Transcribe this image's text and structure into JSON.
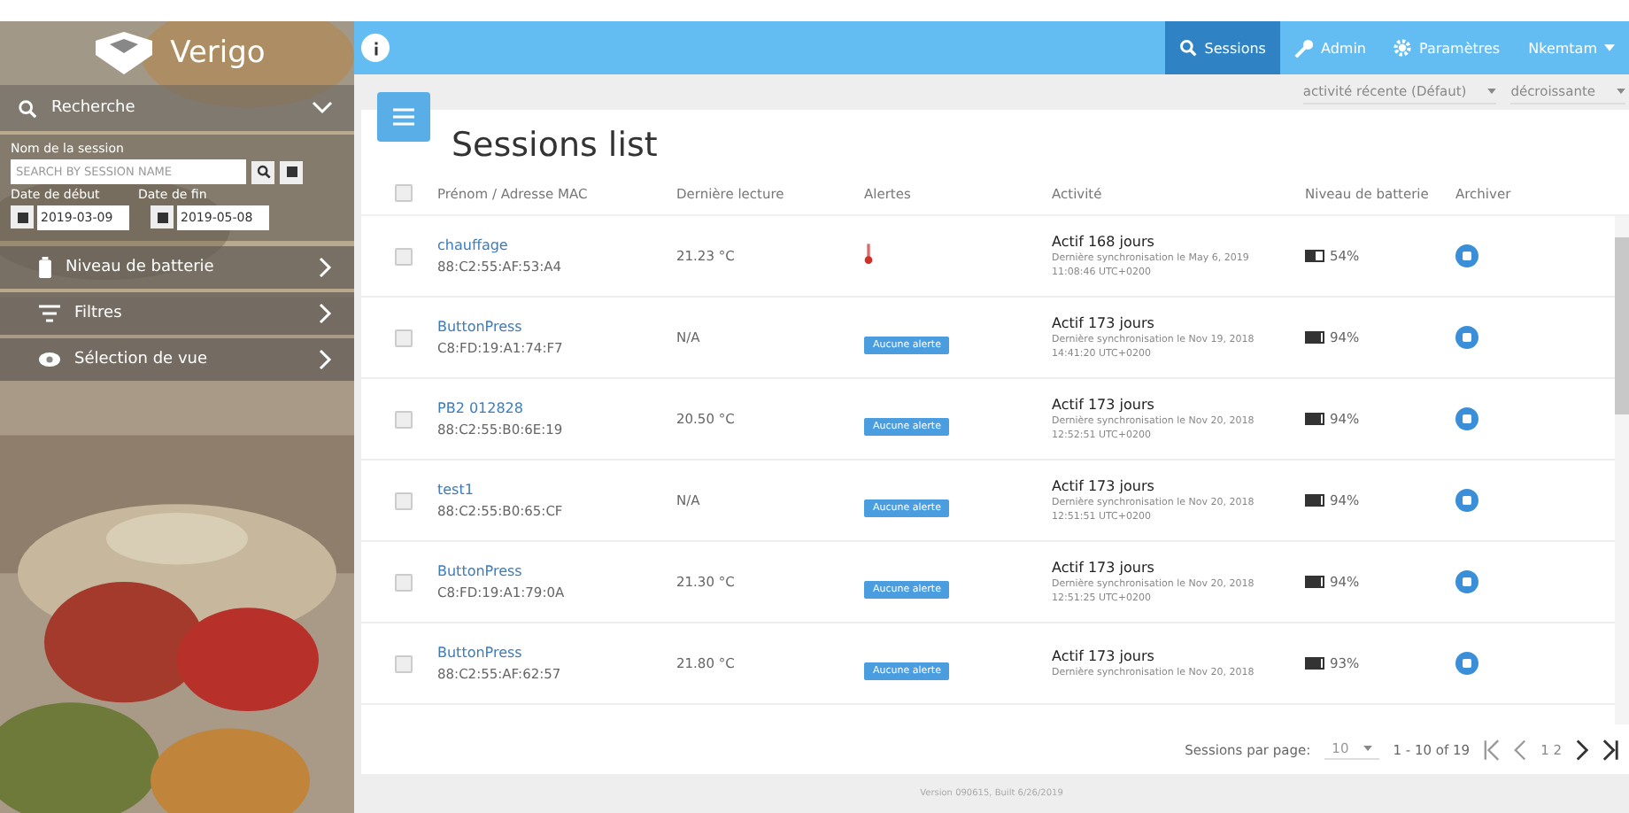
{
  "sidebar": {
    "logo": "Verigo",
    "search": {
      "title": "Recherche",
      "expanded": true,
      "name_label": "Nom de la session",
      "placeholder": "SEARCH BY SESSION NAME",
      "start_label": "Date de début",
      "end_label": "Date de fin",
      "start_date": "2019-03-09",
      "end_date": "2019-05-08"
    },
    "items": [
      {
        "label": "Niveau de batterie"
      },
      {
        "label": "Filtres"
      },
      {
        "label": "Sélection de vue"
      }
    ]
  },
  "navbar": {
    "items": [
      {
        "label": "Sessions",
        "selected": true
      },
      {
        "label": "Admin",
        "selected": false
      },
      {
        "label": "Paramètres",
        "selected": false
      },
      {
        "label": "Nkemtam",
        "selected": false
      }
    ]
  },
  "sort": {
    "field": "activité récente (Défaut)",
    "order": "décroissante"
  },
  "title": "Sessions list",
  "table": {
    "all_checked": false,
    "columns": [
      "Prénom / Adresse MAC",
      "Dernière lecture",
      "Alertes",
      "Activité",
      "Niveau de batterie",
      "Archiver"
    ],
    "rows": [
      {
        "checked": false,
        "name": "chauffage",
        "mac": "88:C2:55:AF:53:A4",
        "reading": "21.23 °C",
        "alert": {
          "kind": "thermometer"
        },
        "activity": "Actif 168 jours",
        "sync": "Dernière synchronisation le May 6, 2019",
        "time": "11:08:46 UTC+0200",
        "level": 0.54,
        "battery": "54%"
      },
      {
        "checked": false,
        "name": "ButtonPress",
        "mac": "C8:FD:19:A1:74:F7",
        "reading": "N/A",
        "alert": {
          "kind": "badge",
          "label": "Aucune alerte"
        },
        "activity": "Actif 173 jours",
        "sync": "Dernière synchronisation le Nov 19, 2018",
        "time": "14:41:20 UTC+0200",
        "level": 0.94,
        "battery": "94%"
      },
      {
        "checked": false,
        "name": "PB2 012828",
        "mac": "88:C2:55:B0:6E:19",
        "reading": "20.50 °C",
        "alert": {
          "kind": "badge",
          "label": "Aucune alerte"
        },
        "activity": "Actif 173 jours",
        "sync": "Dernière synchronisation le Nov 20, 2018",
        "time": "12:52:51 UTC+0200",
        "level": 0.94,
        "battery": "94%"
      },
      {
        "checked": false,
        "name": "test1",
        "mac": "88:C2:55:B0:65:CF",
        "reading": "N/A",
        "alert": {
          "kind": "badge",
          "label": "Aucune alerte"
        },
        "activity": "Actif 173 jours",
        "sync": "Dernière synchronisation le Nov 20, 2018",
        "time": "12:51:51 UTC+0200",
        "level": 0.94,
        "battery": "94%"
      },
      {
        "checked": false,
        "name": "ButtonPress",
        "mac": "C8:FD:19:A1:79:0A",
        "reading": "21.30 °C",
        "alert": {
          "kind": "badge",
          "label": "Aucune alerte"
        },
        "activity": "Actif 173 jours",
        "sync": "Dernière synchronisation le Nov 20, 2018",
        "time": "12:51:25 UTC+0200",
        "level": 0.94,
        "battery": "94%"
      },
      {
        "checked": false,
        "name": "ButtonPress",
        "mac": "88:C2:55:AF:62:57",
        "reading": "21.80 °C",
        "alert": {
          "kind": "badge",
          "label": "Aucune alerte"
        },
        "activity": "Actif 173 jours",
        "sync": "Dernière synchronisation le Nov 20, 2018",
        "level": 0.93,
        "battery": "93%"
      }
    ]
  },
  "pagination": {
    "label": "Sessions par page:",
    "per_page": "10",
    "range": "1 - 10 of 19",
    "pages": "1 2"
  },
  "footer": "Version 090615, Built 6/26/2019"
}
